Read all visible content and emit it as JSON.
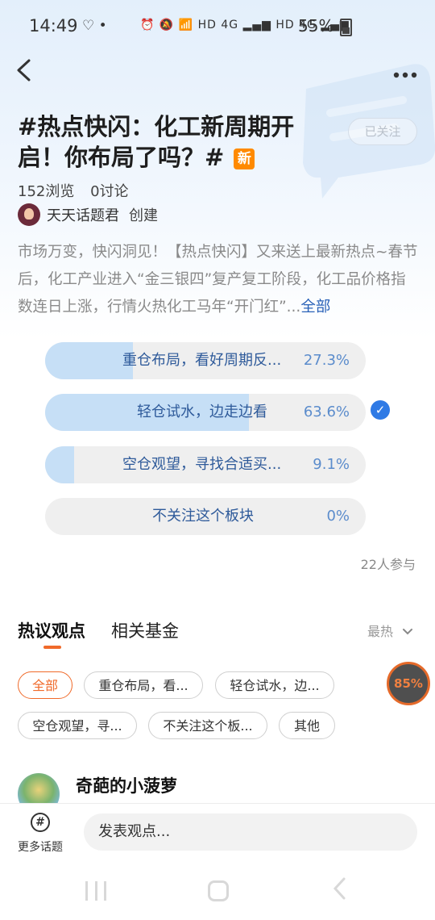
{
  "status_bar": {
    "time": "14:49",
    "icons_left": "♡ •",
    "network": "⏰ 🔕 📶 HD 4G ▂▄▆ HD 4G ▂▄▆",
    "battery": "55%"
  },
  "topic": {
    "title": "#热点快闪：化工新周期开启！你布局了吗？#",
    "new_badge": "新",
    "follow_label": "已关注",
    "views": "152浏览",
    "discussions": "0讨论",
    "creator_name": "天天话题君",
    "creator_role": "创建",
    "description": "市场万变，快闪洞见！【热点快闪】又来送上最新热点~春节后，化工产业进入“金三银四”复产复工阶段，化工品价格指数连日上涨，行情火热化工马年“开门红”...",
    "description_more": "全部"
  },
  "poll": {
    "options": [
      {
        "label": "重仓布局，看好周期反...",
        "percent": "27.3%",
        "share": 0.273
      },
      {
        "label": "轻仓试水，边走边看",
        "percent": "63.6%",
        "share": 0.636
      },
      {
        "label": "空仓观望，寻找合适买...",
        "percent": "9.1%",
        "share": 0.091
      },
      {
        "label": "不关注这个板块",
        "percent": "0%",
        "share": 0
      }
    ],
    "selected_index": 1,
    "participants": "22人参与"
  },
  "tabs": {
    "active": "热议观点",
    "second": "相关基金",
    "sort_label": "最热"
  },
  "filters": [
    "全部",
    "重仓布局，看...",
    "轻仓试水，边...",
    "空仓观望，寻...",
    "不关注这个板...",
    "其他"
  ],
  "progress_badge": "85%",
  "post": {
    "author": "奇葩的小菠萝"
  },
  "bottom": {
    "more_topics": "更多话题",
    "input_placeholder": "发表观点..."
  },
  "colors": {
    "accent": "#f06a2a",
    "poll_fill": "#c6dff6",
    "link": "#2a62b8",
    "check": "#2f7ae5"
  }
}
